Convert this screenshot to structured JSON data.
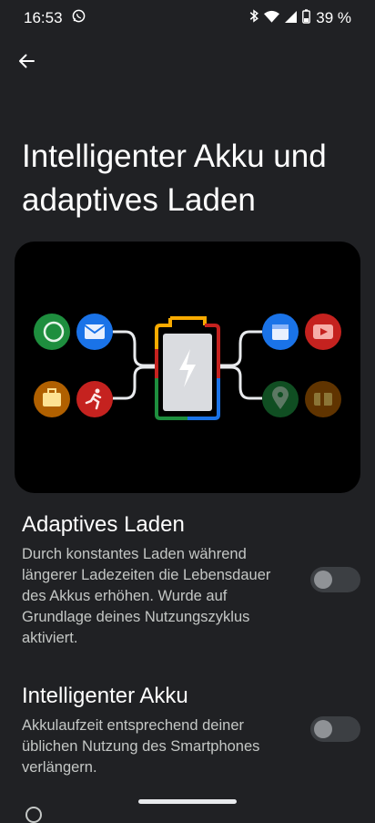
{
  "status": {
    "time": "16:53",
    "battery_percent": "39 %"
  },
  "page": {
    "title": "Intelligenter Akku und adaptives Laden"
  },
  "sections": [
    {
      "title": "Adaptives Laden",
      "description": "Durch konstantes Laden während längerer Ladezeiten die Lebensdauer des Akkus erhöhen. Wurde auf Grundlage deines Nutzungszyklus aktiviert.",
      "toggle_on": false
    },
    {
      "title": "Intelligenter Akku",
      "description": "Akkulaufzeit entsprechend deiner üblichen Nutzung des Smartphones verlängern.",
      "toggle_on": false
    }
  ],
  "icons": {
    "status": [
      "whatsapp-icon",
      "bluetooth-icon",
      "wifi-icon",
      "signal-icon",
      "battery-icon"
    ],
    "illustration": [
      "chat-app-icon",
      "mail-app-icon",
      "suitcase-app-icon",
      "runner-app-icon",
      "calendar-app-icon",
      "video-app-icon",
      "maps-app-icon",
      "wallet-app-icon",
      "battery-charging-icon"
    ]
  },
  "colors": {
    "background": "#202124",
    "illustration_bg": "#000000",
    "toggle_off": "#3c3f43",
    "google_green": "#1e8e3e",
    "google_blue": "#1a73e8",
    "google_red": "#c5221f",
    "google_yellow": "#f9ab00"
  }
}
